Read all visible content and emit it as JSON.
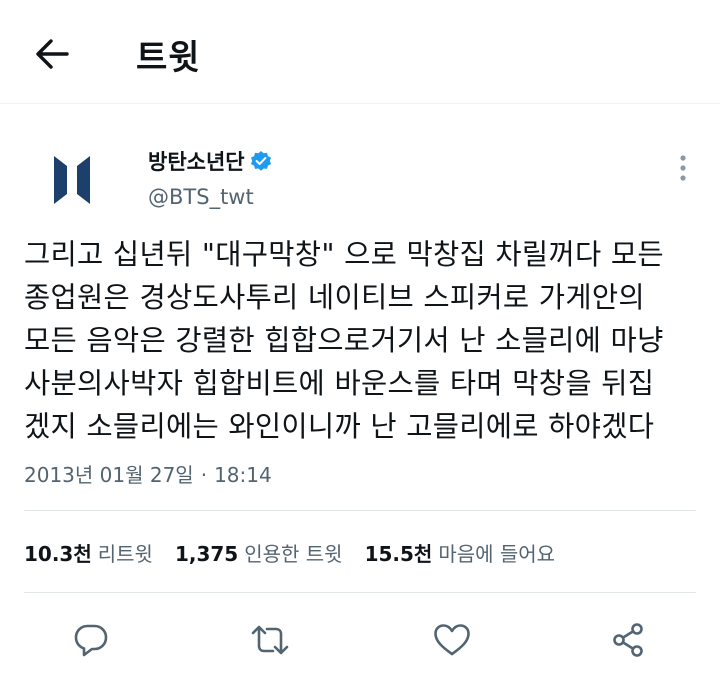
{
  "header": {
    "title": "트윗",
    "back_icon": "arrow-left-icon"
  },
  "author": {
    "display_name": "방탄소년단",
    "handle": "@BTS_twt",
    "verified": true,
    "avatar_icon": "bts-logo-icon",
    "accent_color": "#1d9bf0",
    "logo_color": "#1d3f6b"
  },
  "tweet": {
    "lines": [
      "그리고 십년뒤 \"대구막창\" 으로 막창집 차릴꺼다 모든",
      "종업원은 경상도사투리 네이티브 스피커로 가게안의",
      "모든 음악은 강렬한 힙합으로거기서 난 소믈리에 마냥",
      "사분의사박자 힙합비트에 바운스를 타며 막창을 뒤집",
      "겠지 소믈리에는 와인이니까 난 고믈리에로 하야겠다"
    ],
    "date": "2013년 01월 27일",
    "separator": "·",
    "time": "18:14"
  },
  "stats": [
    {
      "num": "10.3천",
      "label": "리트윗"
    },
    {
      "num": "1,375",
      "label": "인용한 트윗"
    },
    {
      "num": "15.5천",
      "label": "마음에 들어요"
    }
  ],
  "actions": [
    "reply-icon",
    "retweet-icon",
    "like-icon",
    "share-icon"
  ],
  "colors": {
    "text": "#0f1419",
    "secondary": "#536471",
    "divider": "#e1e6e9"
  }
}
